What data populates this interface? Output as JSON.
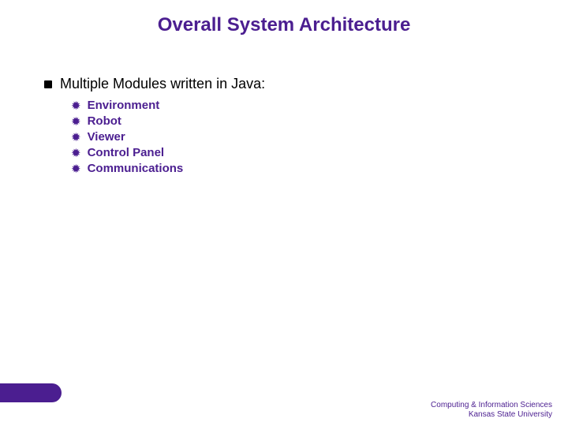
{
  "title": "Overall System Architecture",
  "body": {
    "l1": "Multiple Modules written in Java:",
    "l2": {
      "0": "Environment",
      "1": "Robot",
      "2": "Viewer",
      "3": "Control Panel",
      "4": "Communications"
    }
  },
  "footer": {
    "line1": "Computing & Information Sciences",
    "line2": "Kansas State University"
  },
  "bullets": {
    "star": "✹"
  }
}
